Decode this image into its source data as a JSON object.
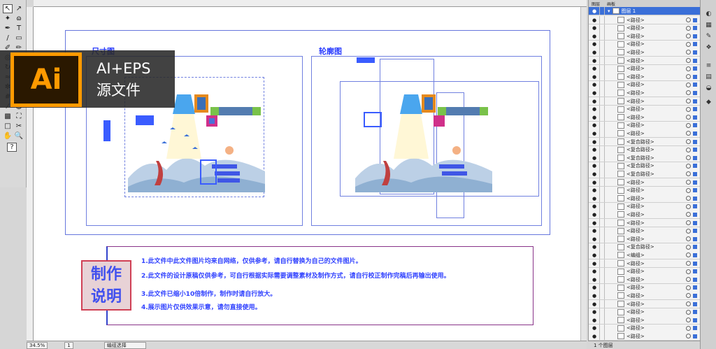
{
  "toolbox": {
    "tools": [
      "select-tool",
      "direct-select-tool",
      "magic-wand-tool",
      "lasso-tool",
      "pen-tool",
      "type-tool",
      "line-tool",
      "rectangle-tool",
      "brush-tool",
      "pencil-tool",
      "blob-brush-tool",
      "eraser-tool",
      "rotate-tool",
      "scale-tool",
      "warp-tool",
      "free-transform-tool",
      "symbol-sprayer-tool",
      "column-graph-tool",
      "mesh-tool",
      "gradient-tool",
      "eyedropper-tool",
      "blend-tool",
      "live-paint-tool",
      "live-paint-select-tool",
      "artboard-tool",
      "slice-tool",
      "hand-tool",
      "zoom-tool"
    ],
    "help_glyph": "?"
  },
  "badge": {
    "logo_text": "Ai",
    "line1": "AI+EPS",
    "line2": "源文件"
  },
  "canvas": {
    "left_panel_label": "尺寸图",
    "right_panel_label": "轮廓图",
    "instructions": {
      "seal_line1": "制作",
      "seal_line2": "说明",
      "lines": [
        "1.此文件中此文件图片均来自网络，仅供参考，请自行替换为自己的文件图片。",
        "2.此文件的设计原稿仅供参考，可自行根据实际需要调整素材及制作方式，请自行校正制作完稿后再输出使用。",
        "3.此文件已缩小10倍制作，制作时请自行放大。",
        "4.展示图片仅供效果示意，请勿直接使用。"
      ]
    }
  },
  "layers": {
    "tabs": [
      "图层",
      "画板"
    ],
    "top_layer": "图层 1",
    "rows": [
      "<路径>",
      "<路径>",
      "<路径>",
      "<路径>",
      "<路径>",
      "<路径>",
      "<路径>",
      "<路径>",
      "<路径>",
      "<路径>",
      "<路径>",
      "<路径>",
      "<路径>",
      "<路径>",
      "<路径>",
      "<复合路径>",
      "<复合路径>",
      "<复合路径>",
      "<复合路径>",
      "<复合路径>",
      "<路径>",
      "<路径>",
      "<路径>",
      "<路径>",
      "<路径>",
      "<路径>",
      "<路径>",
      "<路径>",
      "<复合路径>",
      "<编组>",
      "<路径>",
      "<路径>",
      "<路径>",
      "<路径>",
      "<路径>",
      "<路径>",
      "<路径>",
      "<路径>",
      "<路径>",
      "<路径>"
    ],
    "footer": "1 个图层"
  },
  "status": {
    "zoom": "34.5%",
    "page": "1",
    "mode": "编组选择"
  },
  "colors": {
    "accent": "#2a3cff",
    "ai_orange": "#ff9a00",
    "seal_red": "#d04055",
    "selection": "#3a6fd8"
  }
}
